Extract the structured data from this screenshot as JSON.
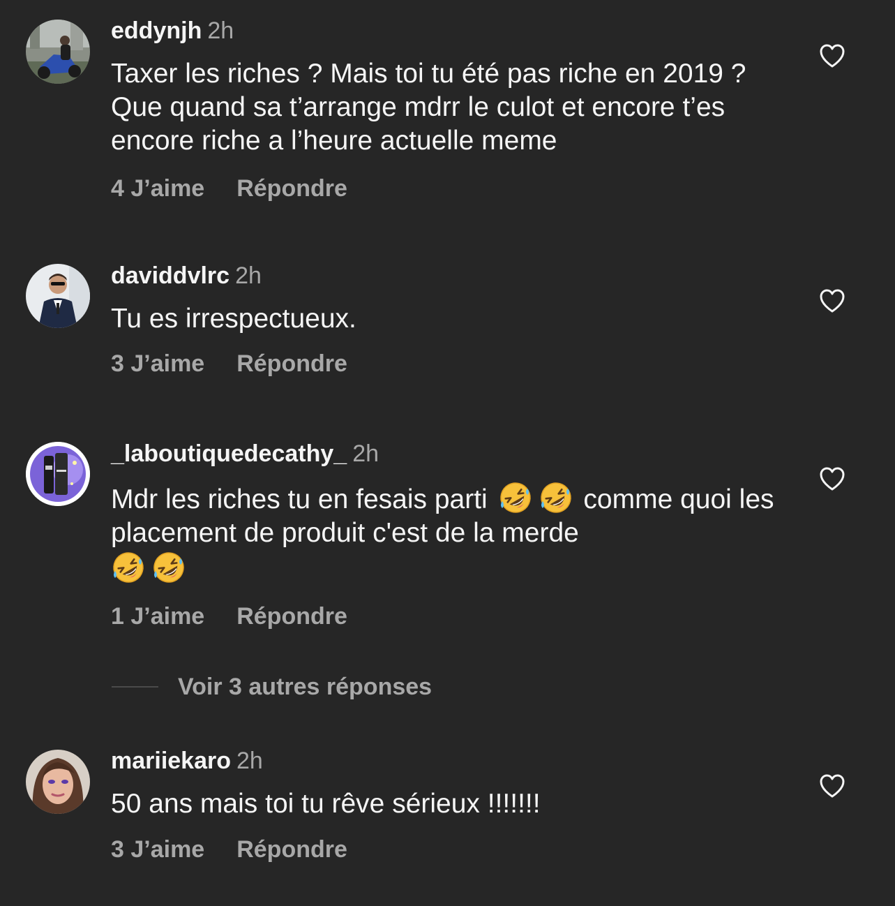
{
  "comments": [
    {
      "username": "eddynjh",
      "time": "2h",
      "text": "Taxer les riches ? Mais toi tu été pas riche en 2019 ? Que quand sa t’arrange mdrr le culot et encore t’es encore riche a l’heure actuelle meme",
      "likes": "4 J’aime",
      "reply": "Répondre"
    },
    {
      "username": "daviddvlrc",
      "time": "2h",
      "text": "Tu es irrespectueux.",
      "likes": "3 J’aime",
      "reply": "Répondre"
    },
    {
      "username": "_laboutiquedecathy_",
      "time": "2h",
      "text_part1": "Mdr les riches tu en fesais parti",
      "text_part2": "comme quoi les placement de produit c'est de la merde",
      "likes": "1 J’aime",
      "reply": "Répondre"
    },
    {
      "username": "mariiekaro",
      "time": "2h",
      "text": "50 ans mais toi tu rêve sérieux !!!!!!!",
      "likes": "3 J’aime",
      "reply": "Répondre"
    }
  ],
  "view_more": "Voir 3 autres réponses",
  "icons": {
    "like": "heart-outline-icon",
    "emoji": "rolling-on-the-floor-laughing-emoji"
  },
  "colors": {
    "background": "#262626",
    "primary_text": "#f5f5f5",
    "secondary_text": "#a8a8a8"
  }
}
